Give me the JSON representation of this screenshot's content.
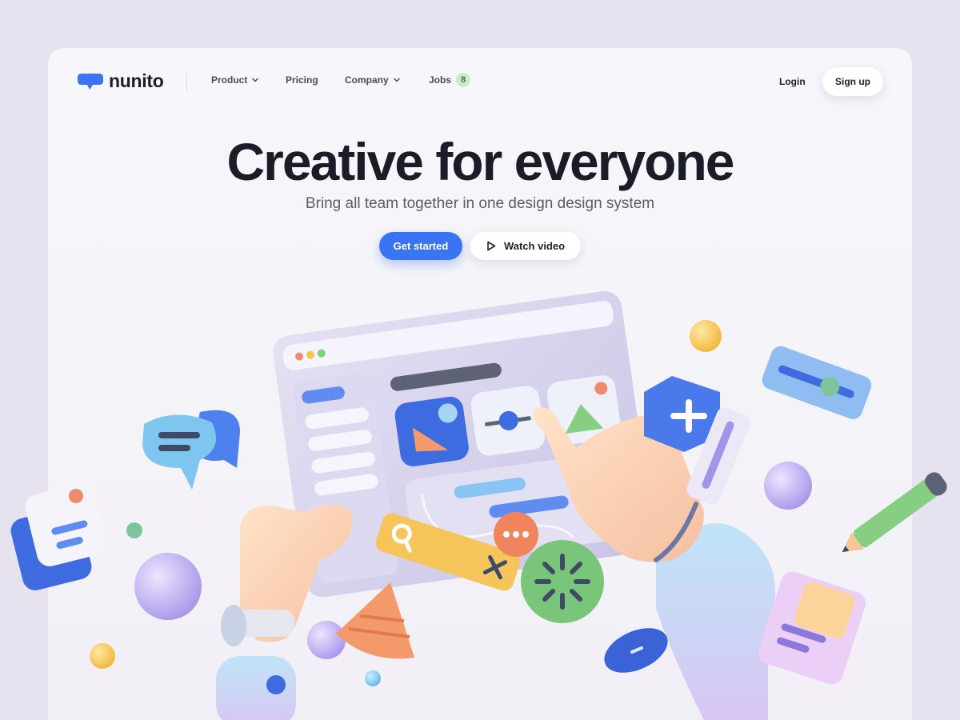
{
  "brand": {
    "name": "nunito",
    "accent": "#3a74f2"
  },
  "nav": {
    "items": [
      {
        "label": "Product",
        "has_dropdown": true
      },
      {
        "label": "Pricing",
        "has_dropdown": false
      },
      {
        "label": "Company",
        "has_dropdown": true
      },
      {
        "label": "Jobs",
        "badge": "8"
      }
    ],
    "login_label": "Login",
    "signup_label": "Sign up"
  },
  "hero": {
    "title": "Creative for everyone",
    "subtitle": "Bring all team together in one design design system",
    "primary_cta": "Get started",
    "secondary_cta": "Watch video",
    "secondary_icon": "play-icon"
  },
  "illustration": {
    "name": "3d-hands-holding-tablet-illustration"
  }
}
